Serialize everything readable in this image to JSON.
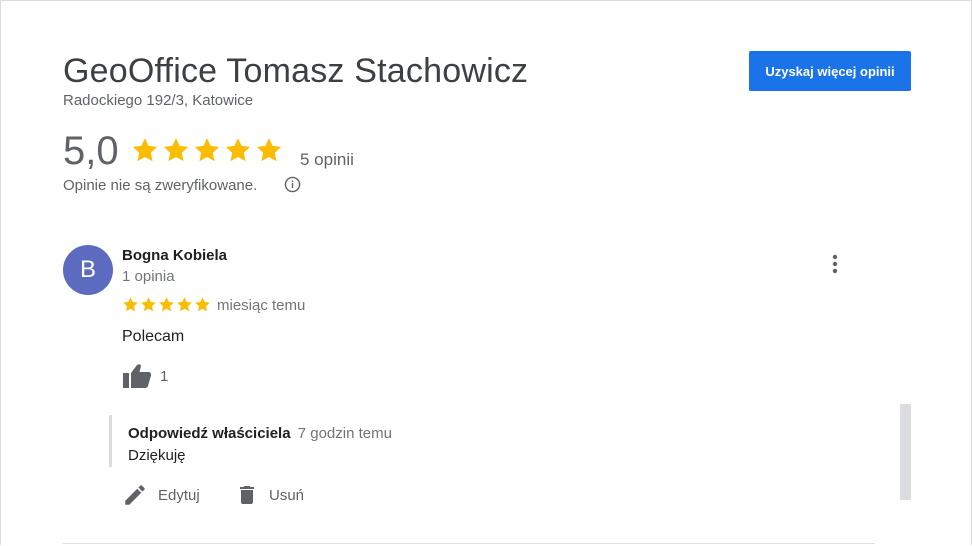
{
  "business": {
    "name": "GeoOffice Tomasz Stachowicz",
    "address": "Radockiego 192/3, Katowice",
    "cta_label": "Uzyskaj więcej opinii"
  },
  "summary": {
    "rating": "5,0",
    "stars": 5,
    "review_count": "5 opinii",
    "unverified_note": "Opinie nie są zweryfikowane."
  },
  "review": {
    "avatar_letter": "B",
    "reviewer_name": "Bogna Kobiela",
    "reviewer_reviews": "1 opinia",
    "stars": 5,
    "time": "miesiąc temu",
    "text": "Polecam",
    "likes": "1",
    "reply": {
      "label": "Odpowiedź właściciela",
      "time": "7 godzin temu",
      "text": "Dziękuję"
    },
    "edit_label": "Edytuj",
    "delete_label": "Usuń"
  },
  "colors": {
    "accent": "#1a73e8",
    "star": "#fbbc04",
    "avatar": "#5c6bc0"
  }
}
